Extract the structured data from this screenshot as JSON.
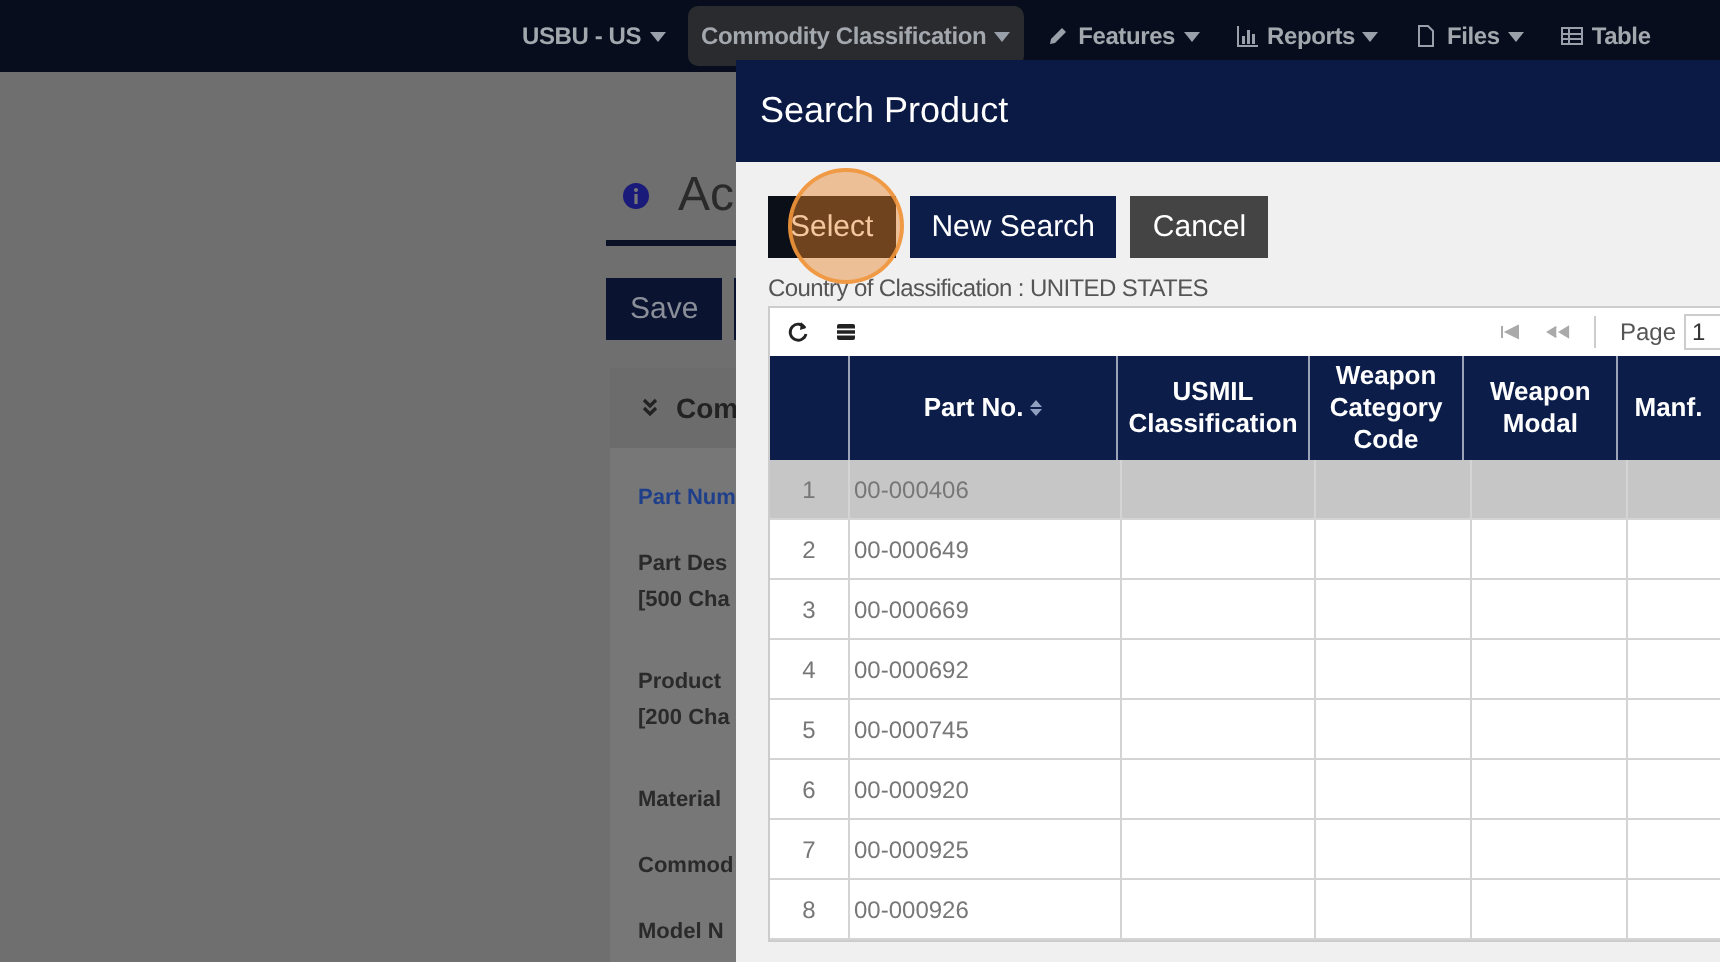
{
  "navbar": {
    "items": [
      {
        "label": "USBU - US",
        "selected": false
      },
      {
        "label": "Commodity Classification",
        "selected": true
      },
      {
        "label": "Features",
        "selected": false
      },
      {
        "label": "Reports",
        "selected": false
      },
      {
        "label": "Files",
        "selected": false
      },
      {
        "label": "Table",
        "selected": false
      }
    ]
  },
  "page": {
    "title": "Ac",
    "save_button": "Save",
    "panel": {
      "title": "Com",
      "fields": [
        {
          "kind": "link",
          "lines": [
            "Part Num"
          ]
        },
        {
          "kind": "label",
          "lines": [
            "Part Des",
            "[500 Cha"
          ]
        },
        {
          "kind": "label",
          "lines": [
            "Product",
            "[200 Cha"
          ]
        },
        {
          "kind": "label",
          "lines": [
            "Material"
          ]
        },
        {
          "kind": "label",
          "lines": [
            "Commod"
          ]
        },
        {
          "kind": "label",
          "lines": [
            "Model N"
          ]
        }
      ]
    }
  },
  "modal": {
    "title": "Search Product",
    "buttons": [
      {
        "label": "Select",
        "kind": "dark",
        "clicked": true
      },
      {
        "label": "New Search",
        "kind": "primary",
        "clicked": false
      },
      {
        "label": "Cancel",
        "kind": "secondary",
        "clicked": false
      }
    ],
    "country": "Country of Classification : UNITED STATES",
    "pager": {
      "label": "Page",
      "value": "1"
    },
    "table": {
      "columns": [
        {
          "sortable": false
        },
        {
          "label": "Part No.",
          "sortable": true
        },
        {
          "label": "USMIL Classification",
          "sortable": false
        },
        {
          "label": "Weapon Category Code",
          "sortable": false
        },
        {
          "label": "Weapon Modal",
          "sortable": false
        },
        {
          "label": "Manf.",
          "sortable": false
        }
      ],
      "rows": [
        {
          "num": "1",
          "part_no": "00-000406",
          "selected": true
        },
        {
          "num": "2",
          "part_no": "00-000649",
          "selected": false
        },
        {
          "num": "3",
          "part_no": "00-000669",
          "selected": false
        },
        {
          "num": "4",
          "part_no": "00-000692",
          "selected": false
        },
        {
          "num": "5",
          "part_no": "00-000745",
          "selected": false
        },
        {
          "num": "6",
          "part_no": "00-000920",
          "selected": false
        },
        {
          "num": "7",
          "part_no": "00-000925",
          "selected": false
        },
        {
          "num": "8",
          "part_no": "00-000926",
          "selected": false
        }
      ]
    }
  }
}
